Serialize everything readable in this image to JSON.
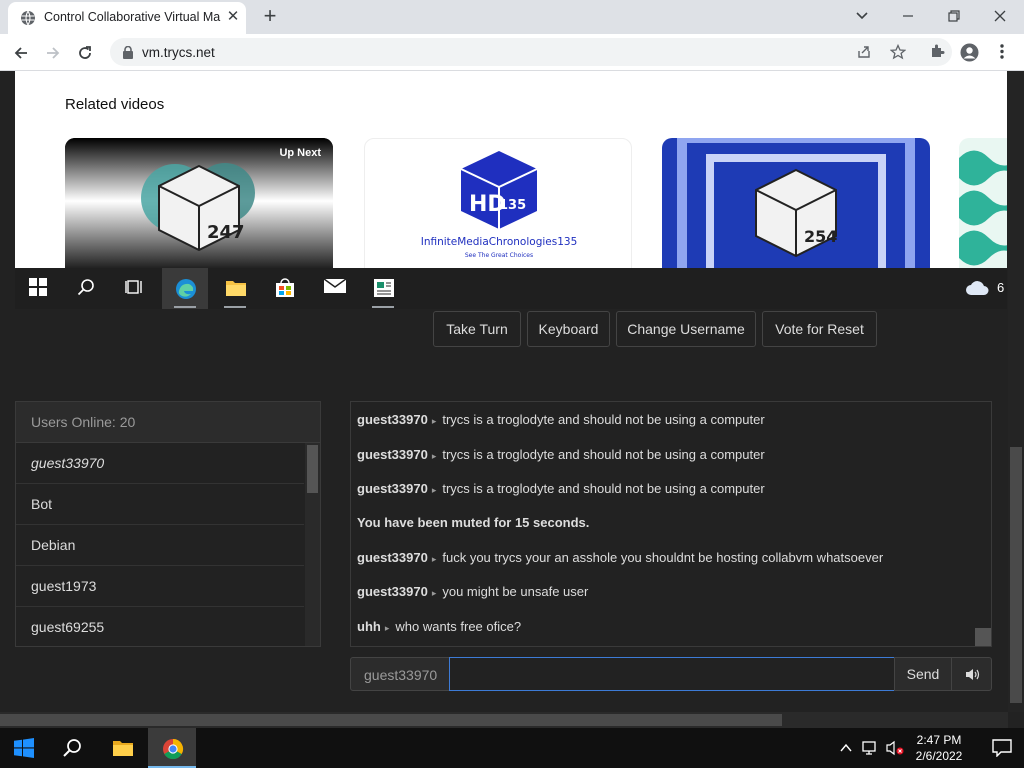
{
  "browser": {
    "tab_title": "Control Collaborative Virtual Ma",
    "tab_close": "✕",
    "new_tab": "+",
    "url": "vm.trycs.net"
  },
  "vm": {
    "related_title": "Related videos",
    "thumbnails": [
      {
        "badge": "Up Next",
        "logo": "247"
      },
      {
        "logo": "InfiniteMediaChronologies135",
        "tagline": "See The Great Choices"
      },
      {
        "logo": "254"
      },
      {
        "logo": ""
      }
    ],
    "weather_temp": "6"
  },
  "controls": {
    "take_turn": "Take Turn",
    "keyboard": "Keyboard",
    "change_username": "Change Username",
    "vote_reset": "Vote for Reset"
  },
  "users": {
    "header": "Users Online: 20",
    "list": [
      "guest33970",
      "Bot",
      "Debian",
      "guest1973",
      "guest69255"
    ]
  },
  "chat": {
    "messages": [
      {
        "user": "guest33970",
        "text": "trycs is a troglodyte and should not be using a computer"
      },
      {
        "user": "guest33970",
        "text": "trycs is a troglodyte and should not be using a computer"
      },
      {
        "user": "guest33970",
        "text": "trycs is a troglodyte and should not be using a computer"
      },
      {
        "user": "",
        "text": "You have been muted for 15 seconds."
      },
      {
        "user": "guest33970",
        "text": "fuck you trycs your an asshole you shouldnt be hosting collabvm whatsoever"
      },
      {
        "user": "guest33970",
        "text": "you might be unsafe user"
      },
      {
        "user": "uhh",
        "text": "who wants free ofice?"
      }
    ],
    "arrow": "▸",
    "username": "guest33970",
    "input_value": "",
    "send_label": "Send"
  },
  "taskbar": {
    "time": "2:47 PM",
    "date": "2/6/2022"
  },
  "colors": {
    "page_bg": "#222222",
    "accent_blue": "#3d7bd6",
    "chrome_tabstrip": "#dee1e6"
  }
}
